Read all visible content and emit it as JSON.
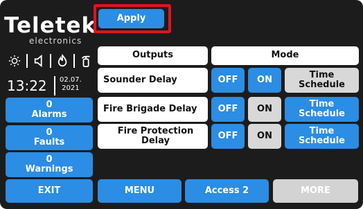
{
  "brand": {
    "logo": "Teletek",
    "sub": "electronics"
  },
  "status_icons": [
    "sun-icon",
    "speaker-icon",
    "flame-icon",
    "extinguisher-icon"
  ],
  "clock": {
    "time": "13:22",
    "date_day": "02.07.",
    "year": "2021"
  },
  "apply_label": "Apply",
  "table": {
    "col_outputs": "Outputs",
    "col_mode": "Mode",
    "rows": [
      {
        "label": "Sounder Delay",
        "off": "OFF",
        "on": "ON",
        "schedule": "Time Schedule",
        "state": "ON"
      },
      {
        "label": "Fire Brigade Delay",
        "off": "OFF",
        "on": "ON",
        "schedule": "Time Schedule",
        "state": "Time Schedule"
      },
      {
        "label": "Fire Protection Delay",
        "off": "OFF",
        "on": "ON",
        "schedule": "Time Schedule",
        "state": "Time Schedule"
      }
    ]
  },
  "sidebar": {
    "alarms": {
      "count": "0",
      "label": "Alarms"
    },
    "faults": {
      "count": "0",
      "label": "Faults"
    },
    "warnings": {
      "count": "0",
      "label": "Warnings"
    }
  },
  "footer": {
    "exit": "EXIT",
    "menu": "MENU",
    "access": "Access 2",
    "more": "MORE"
  },
  "colors": {
    "background": "#1c1c1c",
    "accent": "#2b8de3",
    "highlight": "#e0141e",
    "inactive": "#d8d8d8"
  }
}
